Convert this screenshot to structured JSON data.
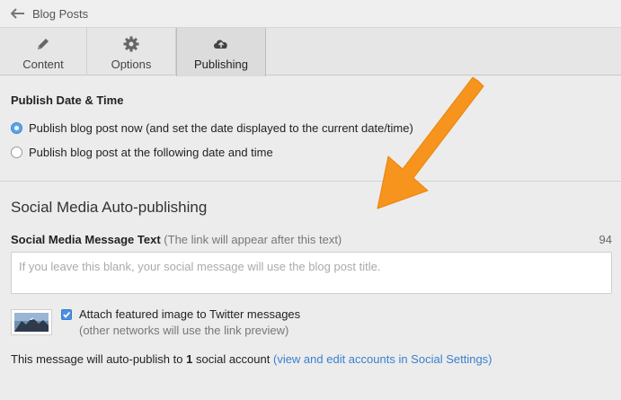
{
  "topbar": {
    "back_label": "Blog Posts"
  },
  "tabs": [
    {
      "label": "Content"
    },
    {
      "label": "Options"
    },
    {
      "label": "Publishing"
    }
  ],
  "publish": {
    "title": "Publish Date & Time",
    "options": [
      "Publish blog post now (and set the date displayed to the current date/time)",
      "Publish blog post at the following date and time"
    ]
  },
  "social": {
    "heading": "Social Media Auto-publishing",
    "message_label": "Social Media Message Text",
    "message_hint": "(The link will appear after this text)",
    "char_count": "94",
    "placeholder": "If you leave this blank, your social message will use the blog post title.",
    "attach_label": "Attach featured image to Twitter messages",
    "attach_sub": "(other networks will use the link preview)",
    "autopub_prefix": "This message will auto-publish to",
    "autopub_count": "1",
    "autopub_suffix": "social account",
    "autopub_link": "(view and edit accounts in Social Settings)"
  },
  "icons": {
    "back": "arrow-back-icon",
    "content": "pencil-icon",
    "options": "gear-icon",
    "publishing": "cloud-upload-icon"
  },
  "colors": {
    "accent_link": "#3a7fcf",
    "arrow": "#f7941d",
    "checkbox": "#4a90e2"
  }
}
